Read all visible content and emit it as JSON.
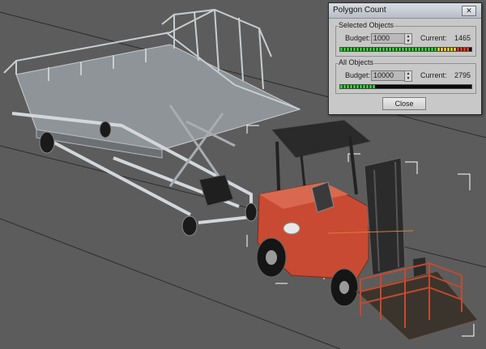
{
  "dialog": {
    "title": "Polygon Count",
    "close_label": "Close",
    "selected": {
      "group_title": "Selected Objects",
      "budget_label": "Budget:",
      "budget_value": "1000",
      "current_label": "Current:",
      "current_value": "1465",
      "meter_fraction": 1.0
    },
    "all": {
      "group_title": "All Objects",
      "budget_label": "Budget:",
      "budget_value": "10000",
      "current_label": "Current:",
      "current_value": "2795",
      "meter_fraction": 0.28
    }
  }
}
